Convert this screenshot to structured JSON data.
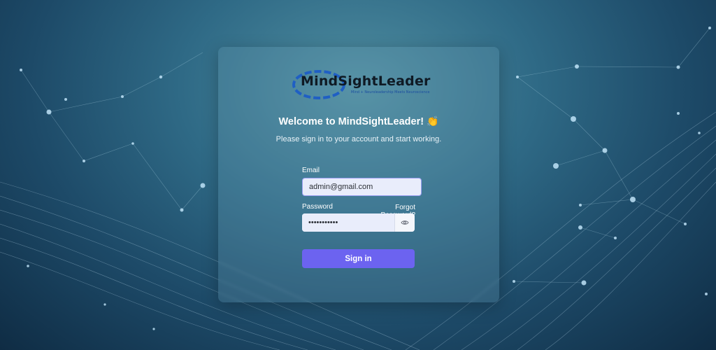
{
  "logo": {
    "name": "MindSightLeader",
    "tagline": "Mind + Neuroleadership Meets Neuroscience",
    "ring_color": "#1f5fc4"
  },
  "welcome": {
    "title": "Welcome to MindSightLeader!",
    "emoji": "👏",
    "subtitle": "Please sign in to your account and start working."
  },
  "form": {
    "email_label": "Email",
    "email_value": "admin@gmail.com",
    "password_label": "Password",
    "password_value": "•••••••••••",
    "forgot_label": "Forgot Password?",
    "signin_label": "Sign in",
    "toggle_icon": "eye-icon"
  },
  "colors": {
    "accent": "#6c63f0",
    "input_bg": "#e9edfb"
  }
}
